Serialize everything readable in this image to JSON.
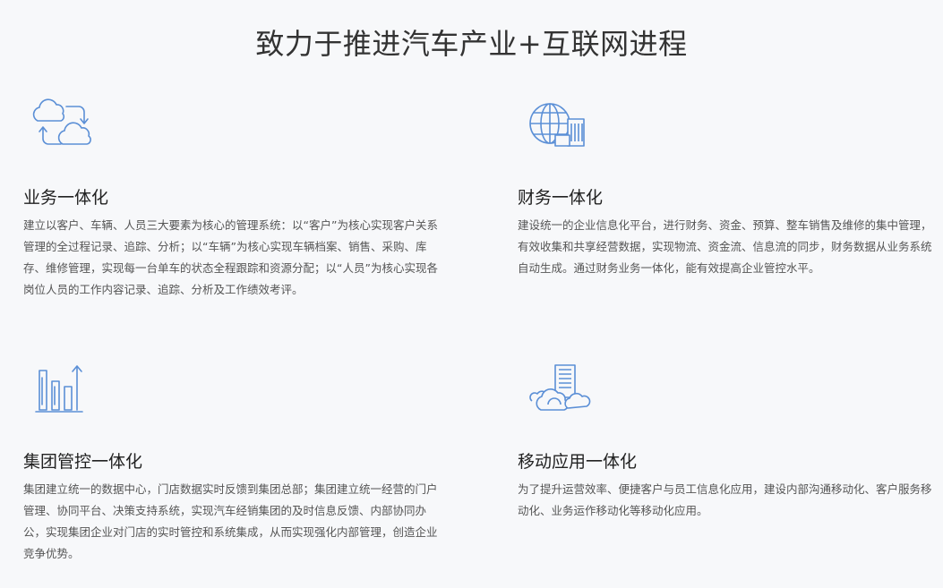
{
  "page": {
    "title": "致力于推进汽车产业+互联网进程"
  },
  "features": [
    {
      "icon": "cloud-sync-icon",
      "title": "业务一体化",
      "desc": "建立以客户、车辆、人员三大要素为核心的管理系统：以“客户”为核心实现客户关系管理的全过程记录、追踪、分析；以“车辆”为核心实现车辆档案、销售、采购、库存、维修管理，实现每一台单车的状态全程跟踪和资源分配；以“人员”为核心实现各岗位人员的工作内容记录、追踪、分析及工作绩效考评。"
    },
    {
      "icon": "globe-building-icon",
      "title": "财务一体化",
      "desc": "建设统一的企业信息化平台，进行财务、资金、预算、整车销售及维修的集中管理，有效收集和共享经营数据，实现物流、资金流、信息流的同步，财务数据从业务系统自动生成。通过财务业务一体化，能有效提高企业管控水平。"
    },
    {
      "icon": "bar-chart-growth-icon",
      "title": "集团管控一体化",
      "desc": "集团建立统一的数据中心，门店数据实时反馈到集团总部；集团建立统一经营的门户管理、协同平台、决策支持系统，实现汽车经销集团的及时信息反馈、内部协同办公，实现集团企业对门店的实时管控和系统集成，从而实现强化内部管理，创造企业竞争优势。"
    },
    {
      "icon": "cloud-building-icon",
      "title": "移动应用一体化",
      "desc": "为了提升运营效率、便捷客户与员工信息化应用，建设内部沟通移动化、客户服务移动化、业务运作移动化等移动化应用。"
    }
  ],
  "colors": {
    "icon_stroke": "#5b8fd6",
    "background": "#f7f8fa"
  }
}
